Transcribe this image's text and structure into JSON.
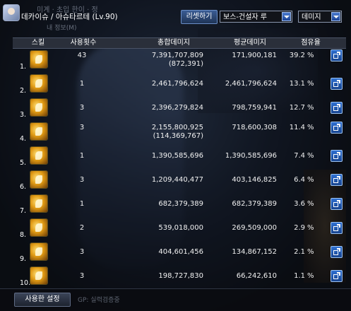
{
  "header": {
    "character_name": "데카이슈 / 아슈타르테 (Lv.90)",
    "ghost_title": "미계 · 초입 한이 · 정",
    "ghost_info": "내 정보(M)",
    "reset_label": "리셋하기",
    "boss_select": "보스-건설자 루",
    "metric_select": "데미지"
  },
  "columns": {
    "skill": "스킬",
    "count": "사용횟수",
    "total": "총합데미지",
    "average": "평균데미지",
    "share": "점유율"
  },
  "rows": [
    {
      "rank": "1.",
      "count": "43",
      "total": "7,391,707,809",
      "total_sub": "(872,391)",
      "average": "171,900,181",
      "share": "39.2",
      "pct": "%"
    },
    {
      "rank": "2.",
      "count": "1",
      "total": "2,461,796,624",
      "total_sub": "",
      "average": "2,461,796,624",
      "share": "13.1",
      "pct": "%"
    },
    {
      "rank": "3.",
      "count": "3",
      "total": "2,396,279,824",
      "total_sub": "",
      "average": "798,759,941",
      "share": "12.7",
      "pct": "%"
    },
    {
      "rank": "4.",
      "count": "3",
      "total": "2,155,800,925",
      "total_sub": "(114,369,767)",
      "average": "718,600,308",
      "share": "11.4",
      "pct": "%"
    },
    {
      "rank": "5.",
      "count": "1",
      "total": "1,390,585,696",
      "total_sub": "",
      "average": "1,390,585,696",
      "share": "7.4",
      "pct": "%"
    },
    {
      "rank": "6.",
      "count": "3",
      "total": "1,209,440,477",
      "total_sub": "",
      "average": "403,146,825",
      "share": "6.4",
      "pct": "%"
    },
    {
      "rank": "7.",
      "count": "1",
      "total": "682,379,389",
      "total_sub": "",
      "average": "682,379,389",
      "share": "3.6",
      "pct": "%"
    },
    {
      "rank": "8.",
      "count": "2",
      "total": "539,018,000",
      "total_sub": "",
      "average": "269,509,000",
      "share": "2.9",
      "pct": "%"
    },
    {
      "rank": "9.",
      "count": "3",
      "total": "404,601,456",
      "total_sub": "",
      "average": "134,867,152",
      "share": "2.1",
      "pct": "%"
    },
    {
      "rank": "10.",
      "count": "3",
      "total": "198,727,830",
      "total_sub": "",
      "average": "66,242,610",
      "share": "1.1",
      "pct": "%"
    }
  ],
  "footer": {
    "used_settings_label": "사용한 설정",
    "ghost_footer": "GP: 실력검증중"
  },
  "icons": {
    "skill": "skill-icon",
    "share": "share-icon",
    "dropdown": "chevron-down-icon"
  },
  "colors": {
    "accent": "#2e6fd1",
    "header_bg": "#2a2f3a",
    "text": "#f2f2f2"
  }
}
